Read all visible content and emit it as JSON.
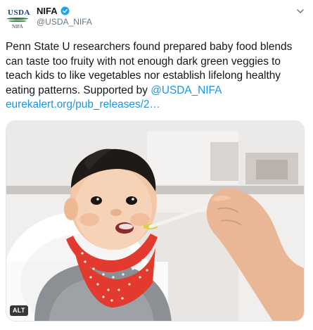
{
  "account": {
    "name": "NIFA",
    "handle": "@USDA_NIFA",
    "logo_main": "USDA",
    "logo_sub": "NIFA",
    "verified": true,
    "avatar_icon": "usda-logo-icon"
  },
  "tweet": {
    "text_plain": "Penn State U researchers found prepared baby food blends can taste too fruity with not enough dark green veggies to teach kids to like vegetables nor establish lifelong healthy eating patterns. Supported by ",
    "mention": "@USDA_NIFA",
    "url_text": "eurekalert.org/pub_releases/2…"
  },
  "media": {
    "alt_label": "ALT"
  },
  "colors": {
    "link": "#1b95e0",
    "verified": "#1da1f2",
    "secondary_text": "#657786",
    "bib_red": "#e23a2e"
  }
}
